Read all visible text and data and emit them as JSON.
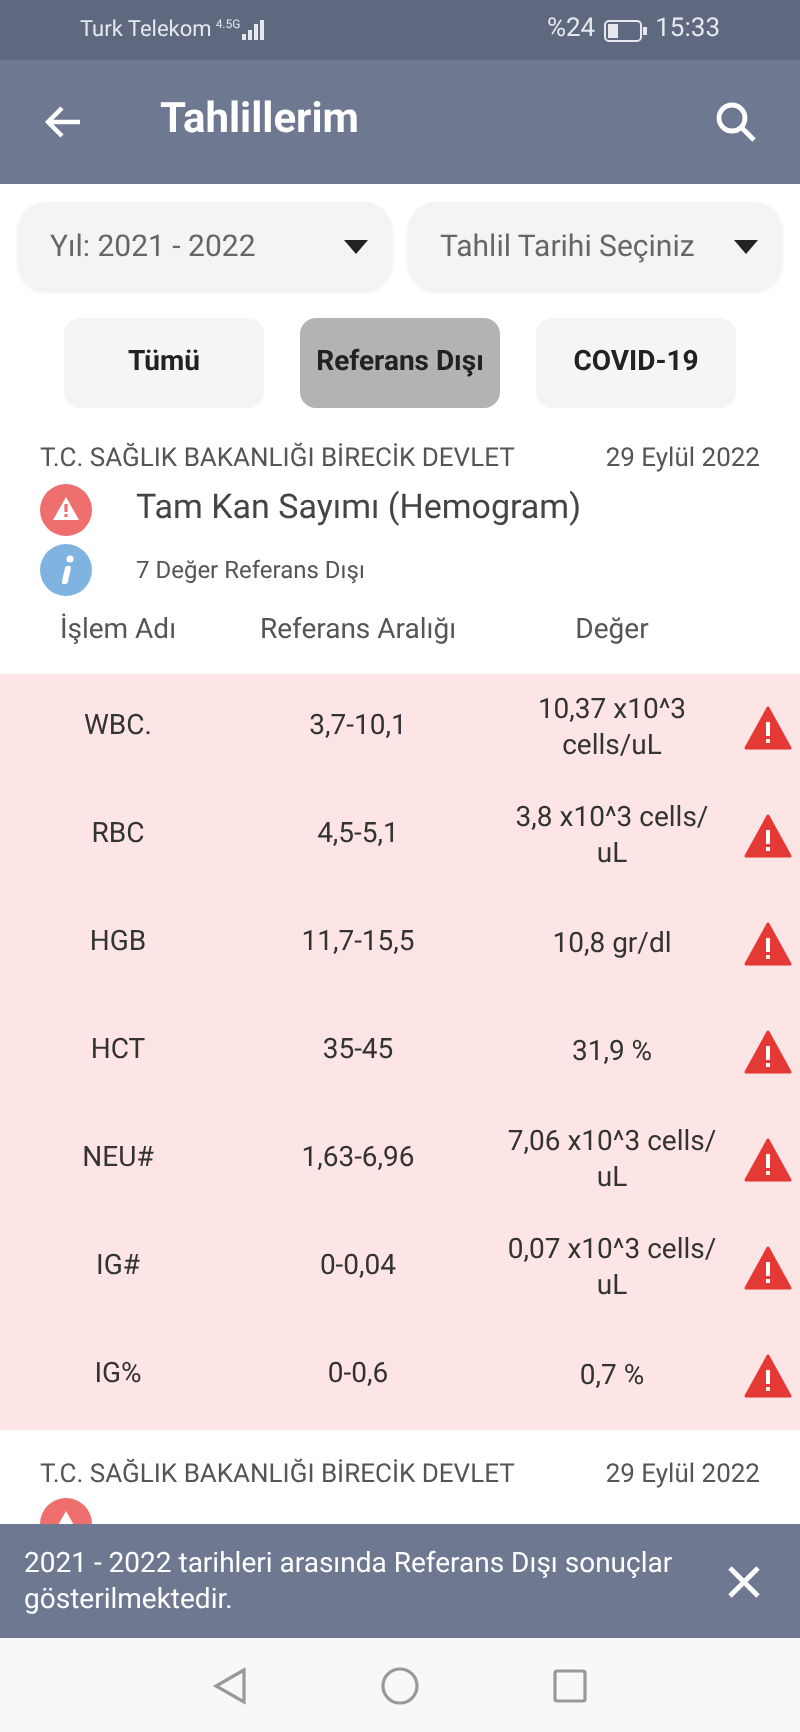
{
  "status_bar": {
    "carrier": "Turk Telekom",
    "network": "4.5G",
    "battery": "%24",
    "time": "15:33"
  },
  "header": {
    "title": "Tahlillerim"
  },
  "filters": [
    {
      "value": "Yıl: 2021 - 2022"
    },
    {
      "value": "Tahlil Tarihi Seçiniz"
    }
  ],
  "tabs": [
    {
      "label": "Tümü",
      "selected": false
    },
    {
      "label": "Referans Dışı",
      "selected": true
    },
    {
      "label": "COVID-19",
      "selected": false
    }
  ],
  "results": [
    {
      "institution": "T.C. SAĞLIK BAKANLIĞI BİRECİK DEVLET",
      "date": "29 Eylül 2022",
      "title": "Tam Kan Sayımı (Hemogram)",
      "info": "7 Değer Referans Dışı",
      "columns": [
        "İşlem Adı",
        "Referans Aralığı",
        "Değer"
      ],
      "rows": [
        {
          "name": "WBC.",
          "range": "3,7-10,1",
          "value": "10,37 x10^3 cells/uL",
          "out_of_range": true
        },
        {
          "name": "RBC",
          "range": "4,5-5,1",
          "value": "3,8 x10^3 cells/ uL",
          "out_of_range": true
        },
        {
          "name": "HGB",
          "range": "11,7-15,5",
          "value": "10,8 gr/dl",
          "out_of_range": true
        },
        {
          "name": "HCT",
          "range": "35-45",
          "value": "31,9 %",
          "out_of_range": true
        },
        {
          "name": "NEU#",
          "range": "1,63-6,96",
          "value": "7,06 x10^3 cells/ uL",
          "out_of_range": true
        },
        {
          "name": "IG#",
          "range": "0-0,04",
          "value": "0,07 x10^3 cells/ uL",
          "out_of_range": true
        },
        {
          "name": "IG%",
          "range": "0-0,6",
          "value": "0,7 %",
          "out_of_range": true
        }
      ]
    },
    {
      "institution": "T.C. SAĞLIK BAKANLIĞI BİRECİK DEVLET",
      "date": "29 Eylül 2022"
    }
  ],
  "snackbar": {
    "message": "2021 - 2022 tarihleri arasında Referans Dışı sonuçlar gösterilmektedir."
  }
}
